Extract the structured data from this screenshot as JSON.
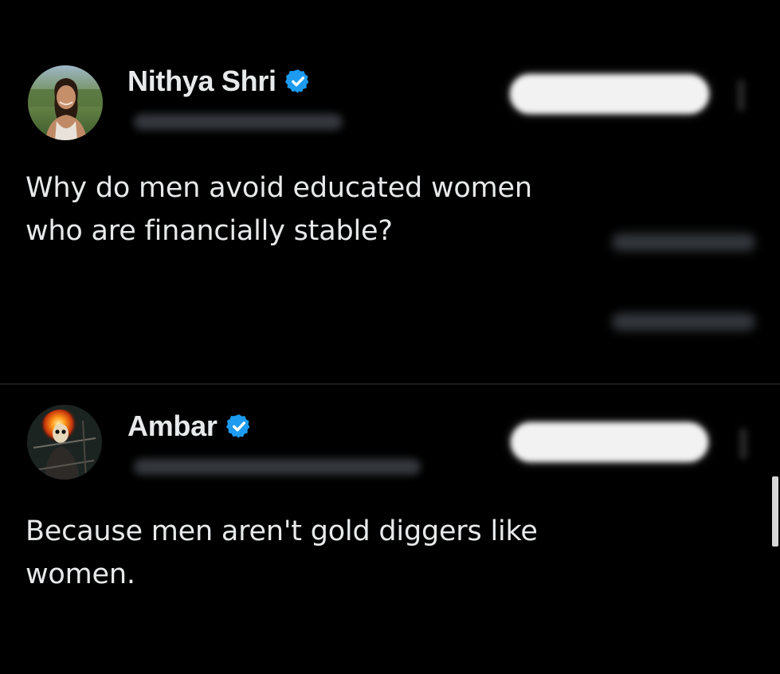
{
  "posts": [
    {
      "author": "Nithya Shri",
      "verified": true,
      "avatar": "profile-photo",
      "text": "Why do men avoid educated women\nwho are financially stable?"
    },
    {
      "author": "Ambar",
      "verified": true,
      "avatar": "ghost-rider-avatar",
      "text": "Because men aren't gold diggers like\nwomen."
    }
  ],
  "icons": {
    "verified_badge": "verified-badge-icon",
    "more_menu": "more-options-icon"
  },
  "colors": {
    "background": "#000000",
    "text": "#e7e9ea",
    "verified_blue": "#1d9bf0",
    "button_bg": "#f2f2f2"
  }
}
